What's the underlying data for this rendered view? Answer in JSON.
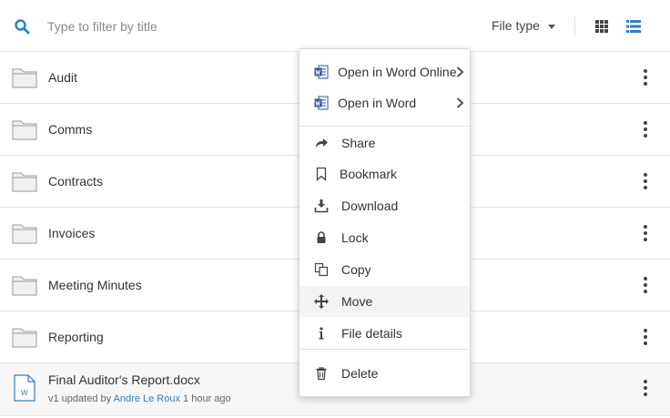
{
  "toolbar": {
    "filter_placeholder": "Type to filter by title",
    "file_type_label": "File type"
  },
  "rows": [
    {
      "label": "Audit"
    },
    {
      "label": "Comms"
    },
    {
      "label": "Contracts"
    },
    {
      "label": "Invoices"
    },
    {
      "label": "Meeting Minutes"
    },
    {
      "label": "Reporting"
    }
  ],
  "file": {
    "name": "Final Auditor's Report.docx",
    "version": "v1",
    "updated_by_text": "updated by",
    "user": "Andre Le Roux",
    "time": "1 hour ago",
    "icon_letter": "W"
  },
  "menu": {
    "open_word_online": "Open in Word Online",
    "open_word": "Open in Word",
    "share": "Share",
    "bookmark": "Bookmark",
    "download": "Download",
    "lock": "Lock",
    "copy": "Copy",
    "move": "Move",
    "file_details": "File details",
    "delete": "Delete"
  },
  "colors": {
    "accent": "#2f7fbf",
    "word_blue": "#2b579a"
  },
  "icons": [
    "search-icon",
    "chevron-down-icon",
    "grid-view-icon",
    "list-view-icon",
    "folder-icon",
    "word-doc-icon",
    "more-vertical-icon",
    "share-icon",
    "bookmark-icon",
    "download-icon",
    "lock-icon",
    "copy-icon",
    "move-icon",
    "info-icon",
    "trash-icon",
    "chevron-right-icon"
  ]
}
